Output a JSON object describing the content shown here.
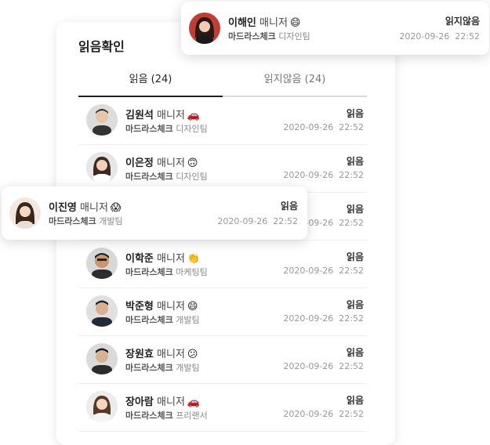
{
  "panel": {
    "title": "읽음확인"
  },
  "tabs": [
    {
      "label": "읽음 (24)"
    },
    {
      "label": "읽지않음 (24)"
    }
  ],
  "rows": [
    {
      "name": "김원석",
      "role": "매니저",
      "emoji": "🚗",
      "company": "마드라스체크",
      "team": "디자인팀",
      "status": "읽음",
      "date": "2020-09-26",
      "time": "22:52"
    },
    {
      "name": "이은정",
      "role": "매니저",
      "emoji": "🙃",
      "company": "마드라스체크",
      "team": "디자인팀",
      "status": "읽음",
      "date": "2020-09-26",
      "time": "22:52"
    },
    {
      "name": "",
      "role": "",
      "emoji": "",
      "company": "",
      "team": "",
      "status": "읽음",
      "date": "2020-09-26",
      "time": "22:52"
    },
    {
      "name": "이학준",
      "role": "매니저",
      "emoji": "👏",
      "company": "마드라스체크",
      "team": "마케팅팀",
      "status": "읽음",
      "date": "2020-09-26",
      "time": "22:52"
    },
    {
      "name": "박준형",
      "role": "매니저",
      "emoji": "😄",
      "company": "마드라스체크",
      "team": "개발팀",
      "status": "읽음",
      "date": "2020-09-26",
      "time": "22:52"
    },
    {
      "name": "장원효",
      "role": "매니저",
      "emoji": "😕",
      "company": "마드라스체크",
      "team": "개발팀",
      "status": "읽음",
      "date": "2020-09-26",
      "time": "22:52"
    },
    {
      "name": "장아람",
      "role": "매니저",
      "emoji": "🚗",
      "company": "마드라스체크",
      "team": "프리랜서",
      "status": "읽음",
      "date": "2020-09-26",
      "time": "22:52"
    }
  ],
  "card_top": {
    "name": "이해인",
    "role": "매니저",
    "emoji": "😄",
    "company": "마드라스체크",
    "team": "디자인팀",
    "status": "읽지않음",
    "date": "2020-09-26",
    "time": "22:52"
  },
  "card_mid": {
    "name": "이진영",
    "role": "매니저",
    "emoji": "😱",
    "company": "마드라스체크",
    "team": "개발팀",
    "status": "읽음",
    "date": "2020-09-26",
    "time": "22:52"
  },
  "colors": {
    "accent": "#222222",
    "muted": "#999999",
    "divider": "#eeeeee"
  }
}
